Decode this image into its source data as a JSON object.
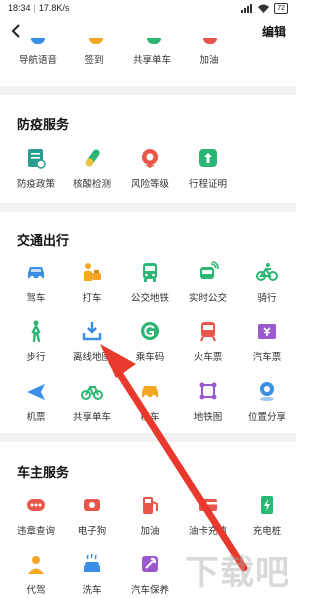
{
  "status": {
    "time": "18:34",
    "speed": "17.8K/s",
    "battery": "72"
  },
  "header": {
    "back_icon": "chevron-left-icon",
    "edit_label": "编辑"
  },
  "top_row": [
    {
      "label": "导航语音",
      "color": "#3a8ee6"
    },
    {
      "label": "签到",
      "color": "#f5a623"
    },
    {
      "label": "共享单车",
      "color": "#2bb673"
    },
    {
      "label": "加油",
      "color": "#e9564a"
    }
  ],
  "sections": {
    "epidemic": {
      "title": "防疫服务",
      "items": [
        {
          "label": "防疫政策",
          "icon": "policy-doc-icon",
          "color": "#2a9d8f"
        },
        {
          "label": "核酸检测",
          "icon": "test-tube-icon",
          "color": "#2bb673"
        },
        {
          "label": "风险等级",
          "icon": "risk-pin-icon",
          "color": "#e9564a"
        },
        {
          "label": "行程证明",
          "icon": "trip-proof-icon",
          "color": "#2bb673"
        }
      ]
    },
    "transport": {
      "title": "交通出行",
      "items": [
        {
          "label": "驾车",
          "icon": "car-icon",
          "color": "#3a8ee6"
        },
        {
          "label": "打车",
          "icon": "taxi-icon",
          "color": "#f5a623"
        },
        {
          "label": "公交地铁",
          "icon": "bus-icon",
          "color": "#2bb673"
        },
        {
          "label": "实时公交",
          "icon": "realtime-bus-icon",
          "color": "#2bb673"
        },
        {
          "label": "骑行",
          "icon": "bike-icon",
          "color": "#2bb673"
        },
        {
          "label": "步行",
          "icon": "walk-icon",
          "color": "#2bb673"
        },
        {
          "label": "离线地图",
          "icon": "download-map-icon",
          "color": "#3a8ee6"
        },
        {
          "label": "乘车码",
          "icon": "ride-code-icon",
          "color": "#2bb673"
        },
        {
          "label": "火车票",
          "icon": "train-icon",
          "color": "#e9564a"
        },
        {
          "label": "汽车票",
          "icon": "ticket-icon",
          "color": "#9b59d0"
        },
        {
          "label": "机票",
          "icon": "plane-icon",
          "color": "#3a8ee6"
        },
        {
          "label": "共享单车",
          "icon": "shared-bike-icon",
          "color": "#2bb673"
        },
        {
          "label": "租车",
          "icon": "rental-car-icon",
          "color": "#f5a623"
        },
        {
          "label": "地铁图",
          "icon": "metro-map-icon",
          "color": "#9b59d0"
        },
        {
          "label": "位置分享",
          "icon": "location-share-icon",
          "color": "#3a8ee6"
        }
      ]
    },
    "owner": {
      "title": "车主服务",
      "items": [
        {
          "label": "违章查询",
          "icon": "violation-icon",
          "color": "#e9564a"
        },
        {
          "label": "电子狗",
          "icon": "e-dog-icon",
          "color": "#e9564a"
        },
        {
          "label": "加油",
          "icon": "fuel-icon",
          "color": "#e9564a"
        },
        {
          "label": "油卡充值",
          "icon": "fuel-card-icon",
          "color": "#e9564a"
        },
        {
          "label": "充电桩",
          "icon": "charger-icon",
          "color": "#2bb673"
        },
        {
          "label": "代驾",
          "icon": "driver-icon",
          "color": "#f5a623"
        },
        {
          "label": "洗车",
          "icon": "car-wash-icon",
          "color": "#3a8ee6"
        },
        {
          "label": "汽车保养",
          "icon": "maintenance-icon",
          "color": "#9b59d0"
        }
      ]
    }
  },
  "watermark": "下载吧"
}
